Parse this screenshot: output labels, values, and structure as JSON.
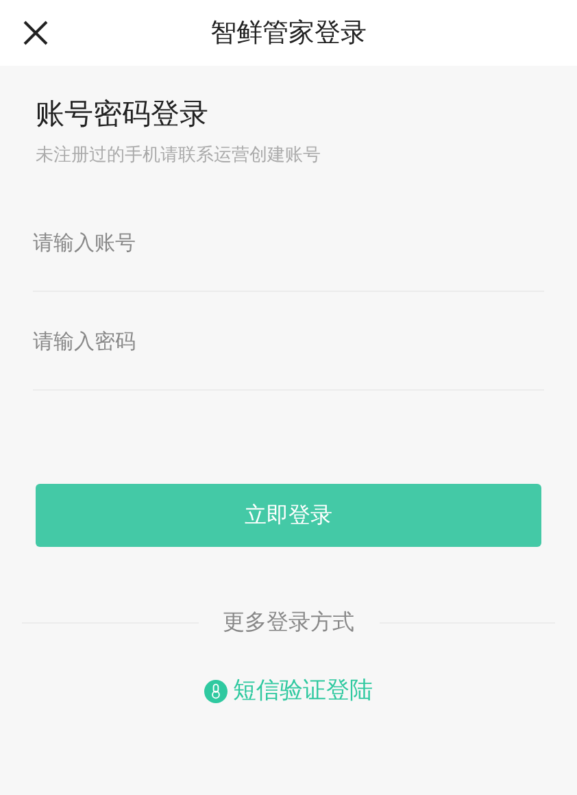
{
  "header": {
    "title": "智鲜管家登录"
  },
  "heading": "账号密码登录",
  "subtitle": "未注册过的手机请联系运营创建账号",
  "fields": [
    {
      "placeholder": "请输入账号"
    },
    {
      "placeholder": "请输入密码"
    }
  ],
  "login_button": "立即登录",
  "more_label": "更多登录方式",
  "sms_link": "短信验证登陆"
}
